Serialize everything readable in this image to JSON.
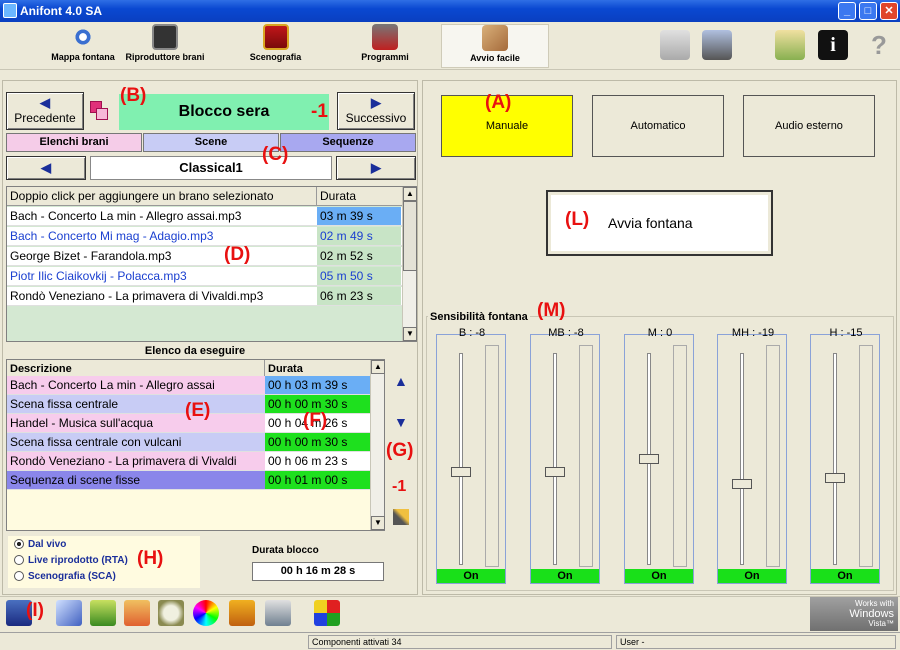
{
  "window": {
    "title": "Anifont 4.0 SA",
    "minimize": "_",
    "maximize": "□",
    "close": "✕"
  },
  "toolbar": {
    "items": [
      {
        "label": "Mappa fontana",
        "icon": "fountain-map-icon"
      },
      {
        "label": "Riproduttore brani",
        "icon": "player-icon"
      },
      {
        "label": "Scenografia",
        "icon": "theater-mask-icon"
      },
      {
        "label": "Programmi",
        "icon": "robot-icon"
      },
      {
        "label": "Avvio facile",
        "icon": "hand-icon"
      }
    ],
    "right_icons": [
      "music-file-icon",
      "tools-icon",
      "checklist-icon",
      "info-icon",
      "help-icon"
    ],
    "help_glyph": "?",
    "info_glyph": "i"
  },
  "nav": {
    "prev": "Precedente",
    "next": "Successivo",
    "block_name": "Blocco sera",
    "minus_one": "-1",
    "prev_arrow": "◀",
    "next_arrow": "▶"
  },
  "annotations": {
    "A": "(A)",
    "B": "(B)",
    "C": "(C)",
    "D": "(D)",
    "E": "(E)",
    "F": "(F)",
    "G": "(G)",
    "H": "(H)",
    "I": "(I)",
    "L": "(L)",
    "M": "(M)"
  },
  "tabs": {
    "elenchi": "Elenchi brani",
    "scene": "Scene",
    "sequenze": "Sequenze"
  },
  "playlist": {
    "name": "Classical1"
  },
  "tracks": {
    "header_desc": "Doppio click per aggiungere un brano selezionato",
    "header_dur": "Durata",
    "rows": [
      {
        "name": "Bach - Concerto La min - Allegro assai.mp3",
        "dur": "03 m 39 s"
      },
      {
        "name": "Bach - Concerto Mi mag - Adagio.mp3",
        "dur": "02 m 49 s"
      },
      {
        "name": "George Bizet - Farandola.mp3",
        "dur": "02 m 52 s"
      },
      {
        "name": "Piotr Ilic Ciaikovkij - Polacca.mp3",
        "dur": "05 m 50 s"
      },
      {
        "name": "Rondò Veneziano - La primavera di Vivaldi.mp3",
        "dur": "06 m 23 s"
      }
    ]
  },
  "queue": {
    "title": "Elenco da eseguire",
    "header_desc": "Descrizione",
    "header_dur": "Durata",
    "rows": [
      {
        "name": "Bach - Concerto La min - Allegro assai",
        "dur": "00 h 03 m 39 s"
      },
      {
        "name": "Scena fissa centrale",
        "dur": "00 h 00 m 30 s"
      },
      {
        "name": "Handel - Musica sull'acqua",
        "dur": "00 h 04 m 26 s"
      },
      {
        "name": "Scena fissa centrale con vulcani",
        "dur": "00 h 00 m 30 s"
      },
      {
        "name": "Rondò Veneziano - La primavera di Vivaldi",
        "dur": "00 h 06 m 23 s"
      },
      {
        "name": "Sequenza di scene fisse",
        "dur": "00 h 01 m 00 s"
      }
    ],
    "up_arrow": "▲",
    "down_arrow": "▼",
    "minus_one": "-1"
  },
  "source": {
    "options": [
      "Dal vivo",
      "Live riprodotto (RTA)",
      "Scenografia (SCA)"
    ],
    "selected": "Dal vivo"
  },
  "durata_blocco": {
    "label": "Durata blocco",
    "value": "00 h 16 m 28 s"
  },
  "modes": {
    "manuale": "Manuale",
    "automatico": "Automatico",
    "audio": "Audio esterno",
    "active_color": "#ffff00"
  },
  "start": {
    "label": "Avvia fontana"
  },
  "sensitivity": {
    "title": "Sensibilità fontana",
    "bands": [
      {
        "label": "B : -8",
        "on": "On",
        "level": 0.44
      },
      {
        "label": "MB : -8",
        "on": "On",
        "level": 0.44
      },
      {
        "label": "M : 0",
        "on": "On",
        "level": 0.5
      },
      {
        "label": "MH : -19",
        "on": "On",
        "level": 0.38
      },
      {
        "label": "H : -15",
        "on": "On",
        "level": 0.41
      }
    ]
  },
  "status": {
    "components": "Componenti attivati 34",
    "user": "User  -"
  },
  "vista_logo": {
    "line1": "Works with",
    "line2": "Windows",
    "line3": "Vista™"
  },
  "bottom_icons": [
    "save-icon",
    "edit-icon",
    "chart-icon",
    "phone-icon",
    "sheep-icon",
    "color-wheel-icon",
    "mask-icon",
    "export-icon",
    "rubik-cube-icon"
  ]
}
